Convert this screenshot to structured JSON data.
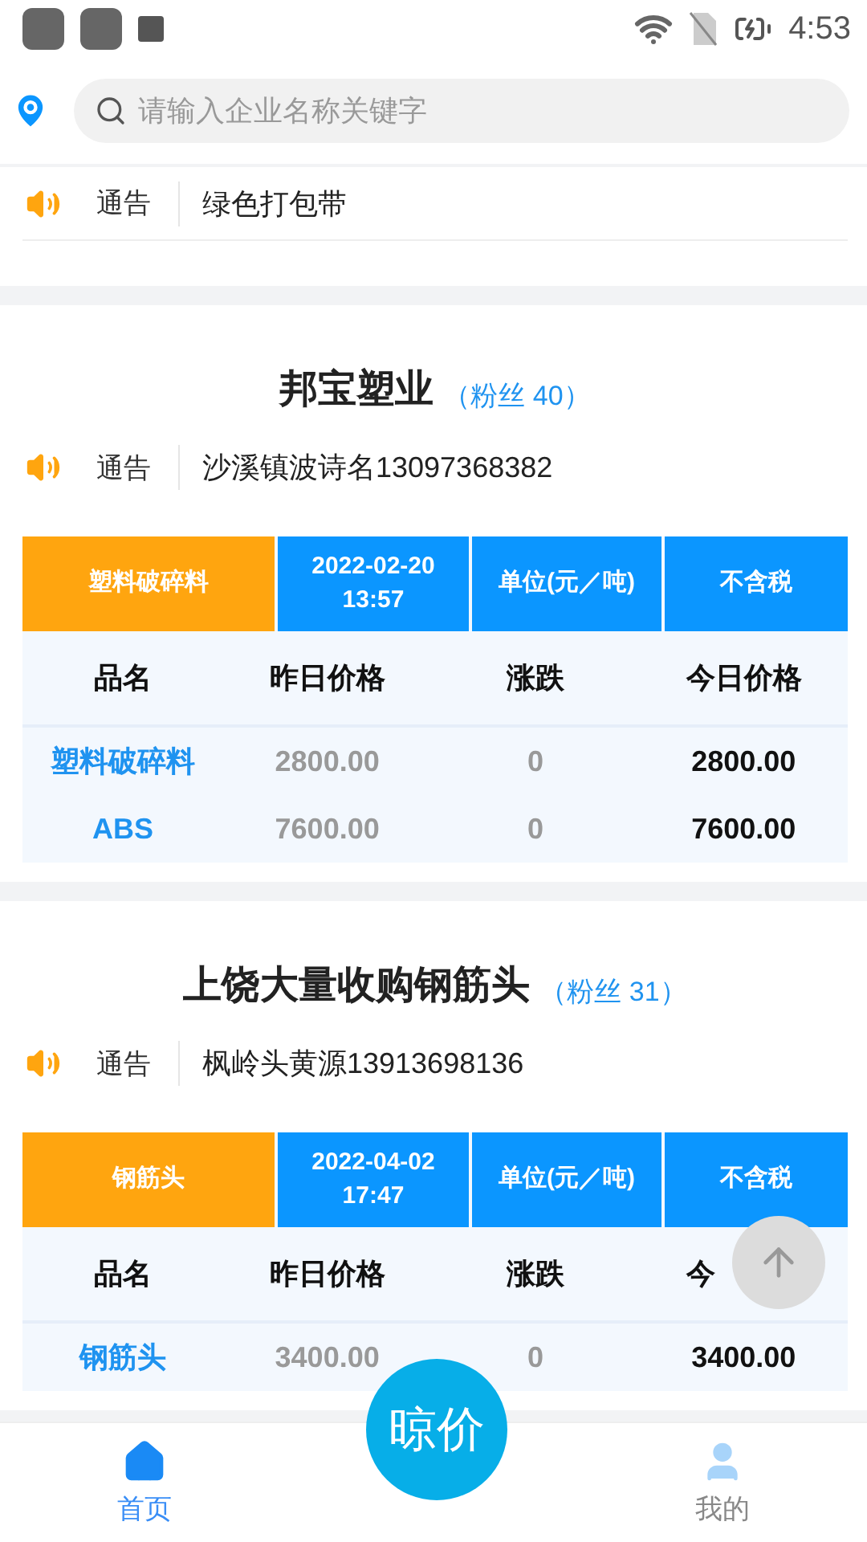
{
  "status_bar": {
    "time": "4:53"
  },
  "search": {
    "placeholder": "请输入企业名称关键字"
  },
  "top_notice": {
    "label": "通告",
    "text": "绿色打包带"
  },
  "companies": [
    {
      "name": "邦宝塑业",
      "fans": "（粉丝 40）",
      "notice_label": "通告",
      "notice": "沙溪镇波诗名13097368382",
      "category": "塑料破碎料",
      "date": "2022-02-20",
      "time": "13:57",
      "unit": "单位(元／吨)",
      "tax": "不含税",
      "columns": [
        "品名",
        "昨日价格",
        "涨跌",
        "今日价格"
      ],
      "rows": [
        {
          "product": "塑料破碎料",
          "yesterday": "2800.00",
          "change": "0",
          "today": "2800.00"
        },
        {
          "product": "ABS",
          "yesterday": "7600.00",
          "change": "0",
          "today": "7600.00"
        }
      ]
    },
    {
      "name": "上饶大量收购钢筋头",
      "fans": "（粉丝 31）",
      "notice_label": "通告",
      "notice": "枫岭头黄源13913698136",
      "category": "钢筋头",
      "date": "2022-04-02",
      "time": "17:47",
      "unit": "单位(元／吨)",
      "tax": "不含税",
      "columns": [
        "品名",
        "昨日价格",
        "涨跌",
        "今"
      ],
      "rows": [
        {
          "product": "钢筋头",
          "yesterday": "3400.00",
          "change": "0",
          "today": "3400.00"
        }
      ]
    }
  ],
  "center_button": "晾价",
  "nav": [
    {
      "label": "首页",
      "selected": true,
      "kind": "home"
    },
    {
      "label": "我的",
      "selected": false,
      "kind": "profile"
    }
  ]
}
